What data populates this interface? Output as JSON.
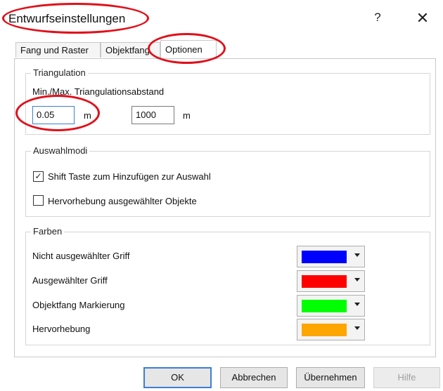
{
  "window": {
    "title": "Entwurfseinstellungen",
    "help_glyph": "?",
    "close_glyph": "✕"
  },
  "tabs": [
    {
      "label": "Fang und Raster",
      "active": false
    },
    {
      "label": "Objektfang",
      "active": false
    },
    {
      "label": "Optionen",
      "active": true
    }
  ],
  "triangulation": {
    "legend": "Triangulation",
    "label": "Min./Max. Triangulationsabstand",
    "min_value": "0.05",
    "max_value": "1000",
    "unit": "m"
  },
  "selection": {
    "legend": "Auswahlmodi",
    "options": [
      {
        "label": "Shift Taste zum Hinzufügen zur Auswahl",
        "checked": true
      },
      {
        "label": "Hervorhebung ausgewählter Objekte",
        "checked": false
      }
    ]
  },
  "colors": {
    "legend": "Farben",
    "items": [
      {
        "label": "Nicht ausgewählter Griff",
        "color": "#0000ff"
      },
      {
        "label": "Ausgewählter Griff",
        "color": "#ff0000"
      },
      {
        "label": "Objektfang Markierung",
        "color": "#00ff00"
      },
      {
        "label": "Hervorhebung",
        "color": "#ffa500"
      }
    ]
  },
  "buttons": {
    "ok": "OK",
    "cancel": "Abbrechen",
    "apply": "Übernehmen",
    "help": "Hilfe"
  },
  "annotation_color": "#e0101a",
  "check_glyph": "✓"
}
